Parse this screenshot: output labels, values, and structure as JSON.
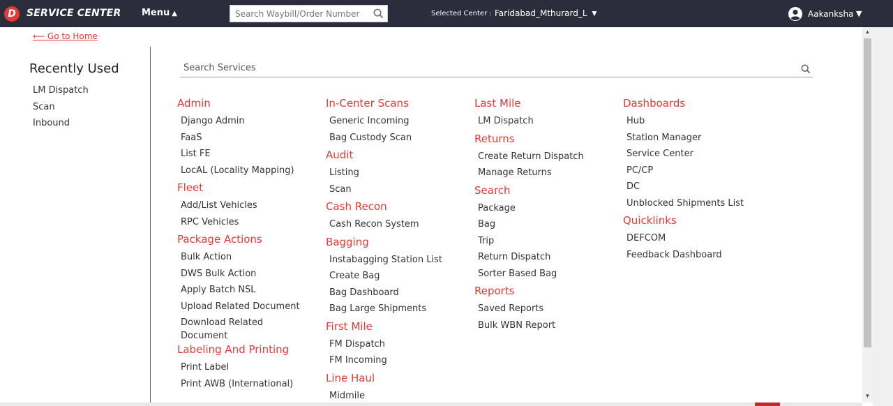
{
  "header": {
    "logo_letter": "D",
    "brand": "SERVICE CENTER",
    "menu_label": "Menu",
    "search_placeholder": "Search Waybill/Order Number",
    "selected_center_label": "Selected Center :",
    "selected_center_value": "Faridabad_Mthurard_L",
    "user_name": "Aakanksha"
  },
  "go_home": "⟵  Go to Home",
  "recent": {
    "title": "Recently Used",
    "items": [
      "LM Dispatch",
      "Scan",
      "Inbound"
    ]
  },
  "services_search_placeholder": "Search Services",
  "columns": [
    {
      "groups": [
        {
          "title": "Admin",
          "items": [
            "Django Admin",
            "FaaS",
            "List FE",
            "LocAL (Locality Mapping)"
          ]
        },
        {
          "title": "Fleet",
          "items": [
            "Add/List Vehicles",
            "RPC Vehicles"
          ]
        },
        {
          "title": "Package Actions",
          "items": [
            "Bulk Action",
            "DWS Bulk Action",
            "Apply Batch NSL",
            "Upload Related Document",
            "Download Related Document"
          ]
        },
        {
          "title": "Labeling And Printing",
          "items": [
            "Print Label",
            "Print AWB (International)"
          ]
        }
      ]
    },
    {
      "groups": [
        {
          "title": "In-Center Scans",
          "items": [
            "Generic Incoming",
            "Bag Custody Scan"
          ]
        },
        {
          "title": "Audit",
          "items": [
            "Listing",
            "Scan"
          ]
        },
        {
          "title": "Cash Recon",
          "items": [
            "Cash Recon System"
          ]
        },
        {
          "title": "Bagging",
          "items": [
            "Instabagging Station List",
            "Create Bag",
            "Bag Dashboard",
            "Bag Large Shipments"
          ]
        },
        {
          "title": "First Mile",
          "items": [
            "FM Dispatch",
            "FM Incoming"
          ]
        },
        {
          "title": "Line Haul",
          "items": [
            "Midmile"
          ]
        }
      ]
    },
    {
      "groups": [
        {
          "title": "Last Mile",
          "items": [
            "LM Dispatch"
          ]
        },
        {
          "title": "Returns",
          "items": [
            "Create Return Dispatch",
            "Manage Returns"
          ]
        },
        {
          "title": "Search",
          "items": [
            "Package",
            "Bag",
            "Trip",
            "Return Dispatch",
            "Sorter Based Bag"
          ]
        },
        {
          "title": "Reports",
          "items": [
            "Saved Reports",
            "Bulk WBN Report"
          ]
        }
      ]
    },
    {
      "groups": [
        {
          "title": "Dashboards",
          "items": [
            "Hub",
            "Station Manager",
            "Service Center",
            "PC/CP",
            "DC",
            "Unblocked Shipments List"
          ]
        },
        {
          "title": "Quicklinks",
          "items": [
            "DEFCOM",
            "Feedback Dashboard"
          ]
        }
      ]
    }
  ],
  "colors": {
    "topbar": "#2c2d3c",
    "accent": "#e53935"
  }
}
